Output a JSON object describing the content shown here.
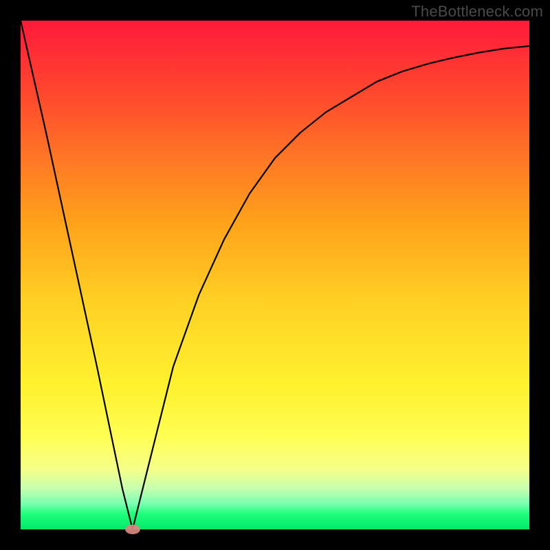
{
  "watermark": {
    "text": "TheBottleneck.com"
  },
  "chart_data": {
    "type": "line",
    "title": "",
    "xlabel": "",
    "ylabel": "",
    "xlim": [
      0,
      100
    ],
    "ylim": [
      0,
      100
    ],
    "grid": false,
    "series": [
      {
        "name": "bottleneck-curve",
        "x": [
          0,
          5,
          10,
          15,
          20,
          22,
          25,
          30,
          35,
          40,
          45,
          50,
          55,
          60,
          65,
          70,
          75,
          80,
          85,
          90,
          95,
          100
        ],
        "values": [
          100,
          78,
          55,
          32,
          8,
          0,
          12,
          32,
          46,
          57,
          66,
          73,
          78,
          82,
          85,
          88,
          90,
          91.5,
          92.7,
          93.7,
          94.5,
          95
        ]
      }
    ],
    "marker": {
      "x": 22,
      "y": 0
    },
    "background": "spectral-gradient-red-to-green"
  }
}
